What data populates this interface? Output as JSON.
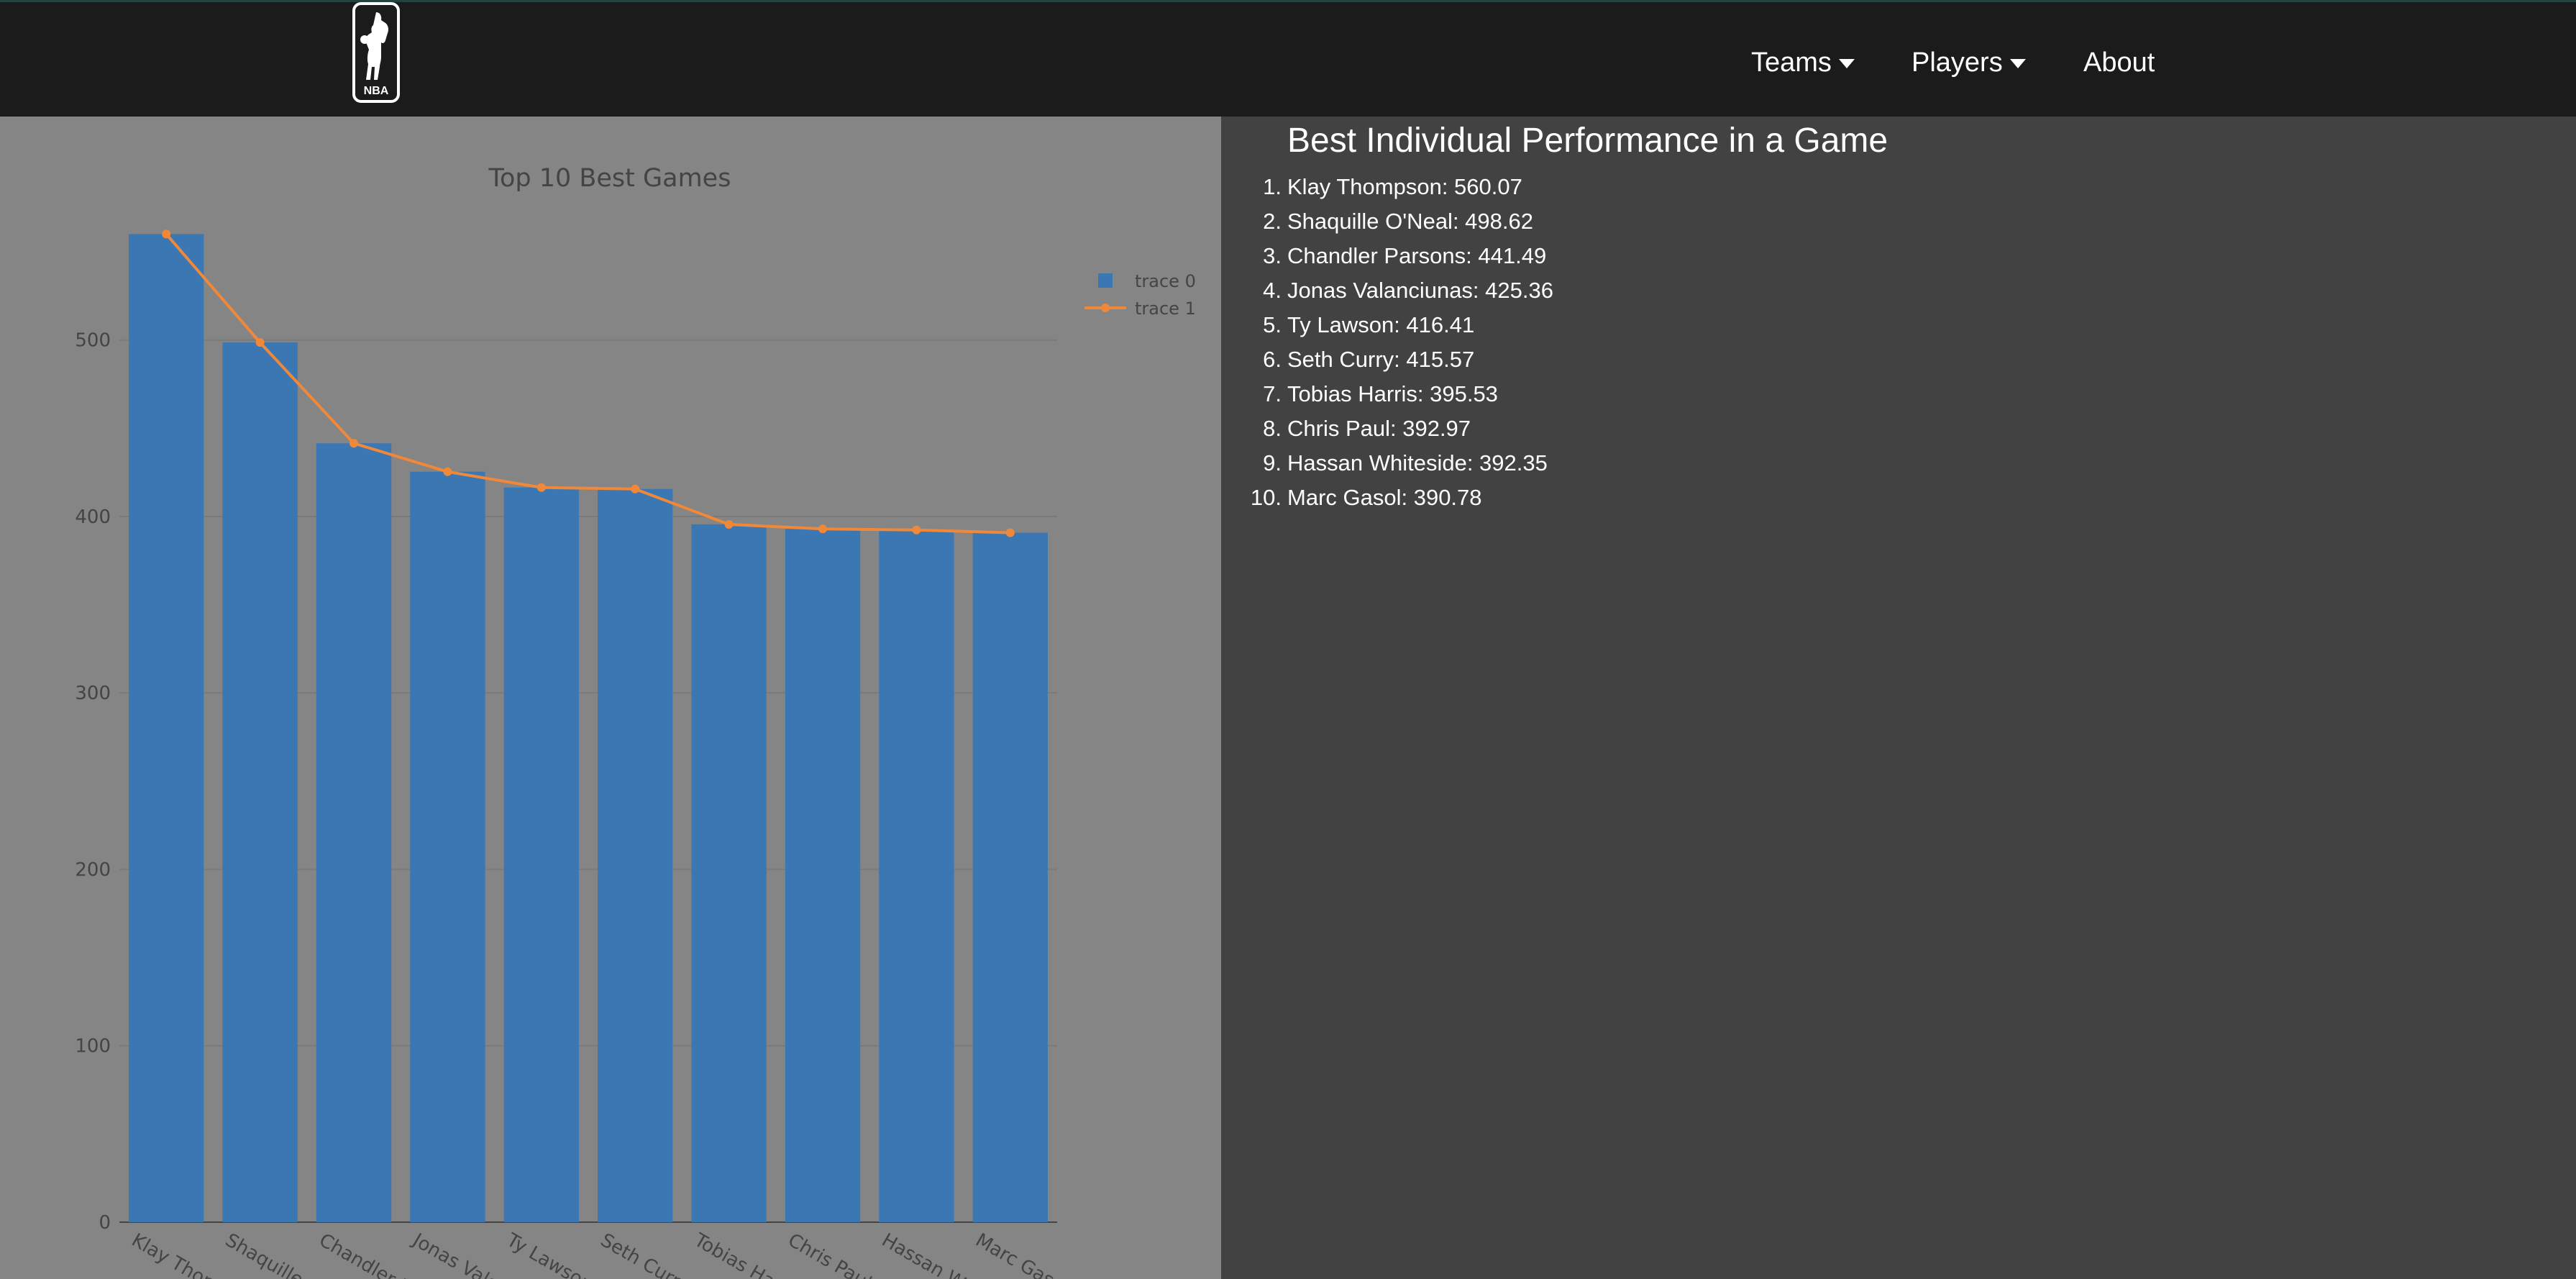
{
  "nav": {
    "logo_text": "NBA",
    "items": [
      {
        "label": "Teams",
        "has_dropdown": true
      },
      {
        "label": "Players",
        "has_dropdown": true
      },
      {
        "label": "About",
        "has_dropdown": false
      }
    ]
  },
  "list": {
    "title": "Best Individual Performance in a Game",
    "items": [
      {
        "rank": "1.",
        "text": "Klay Thompson: 560.07"
      },
      {
        "rank": "2.",
        "text": "Shaquille O'Neal: 498.62"
      },
      {
        "rank": "3.",
        "text": "Chandler Parsons: 441.49"
      },
      {
        "rank": "4.",
        "text": "Jonas Valanciunas: 425.36"
      },
      {
        "rank": "5.",
        "text": "Ty Lawson: 416.41"
      },
      {
        "rank": "6.",
        "text": "Seth Curry: 415.57"
      },
      {
        "rank": "7.",
        "text": "Tobias Harris: 395.53"
      },
      {
        "rank": "8.",
        "text": "Chris Paul: 392.97"
      },
      {
        "rank": "9.",
        "text": "Hassan Whiteside: 392.35"
      },
      {
        "rank": "10.",
        "text": "Marc Gasol: 390.78"
      }
    ]
  },
  "colors": {
    "bar": "#3b77b3",
    "line": "#f0883a",
    "chart_bg": "#858585",
    "right_bg": "#424242",
    "navbar_bg": "#1c1b1c"
  },
  "chart_data": {
    "type": "bar",
    "title": "Top 10 Best Games",
    "categories": [
      "Klay Thompson",
      "Shaquille O'Neal",
      "Chandler Parsons",
      "Jonas Valanciunas",
      "Ty Lawson",
      "Seth Curry",
      "Tobias Harris",
      "Chris Paul",
      "Hassan Whiteside",
      "Marc Gasol"
    ],
    "tick_labels": [
      "Klay Thom",
      "Shaquille O",
      "Chandler P",
      "Jonas Vala",
      "Ty Lawson",
      "Seth Curr",
      "Tobias Ha",
      "Chris Paul",
      "Hassan Wh",
      "Marc Gaso"
    ],
    "series": [
      {
        "name": "trace 0",
        "type": "bar",
        "values": [
          560.07,
          498.62,
          441.49,
          425.36,
          416.41,
          415.57,
          395.53,
          392.97,
          392.35,
          390.78
        ]
      },
      {
        "name": "trace 1",
        "type": "line",
        "values": [
          560.07,
          498.62,
          441.49,
          425.36,
          416.41,
          415.57,
          395.53,
          392.97,
          392.35,
          390.78
        ]
      }
    ],
    "ylim": [
      0,
      590
    ],
    "yticks": [
      0,
      100,
      200,
      300,
      400,
      500
    ],
    "grid": true,
    "legend_position": "top-right"
  }
}
